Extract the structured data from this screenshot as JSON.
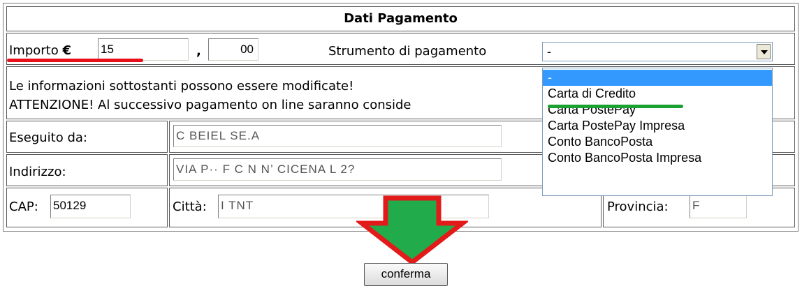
{
  "header": {
    "title": "Dati Pagamento"
  },
  "amount": {
    "label_prefix": "Importo ",
    "currency": "€",
    "euros": "15",
    "separator": ",",
    "cents": "00"
  },
  "payment_method": {
    "label": "Strumento di pagamento",
    "selected": "-",
    "options": [
      "-",
      "Carta di Credito",
      "Carta PostePay",
      "Carta PostePay Impresa",
      "Conto BancoPosta",
      "Conto BancoPosta Impresa"
    ]
  },
  "notice": {
    "line1": "Le informazioni sottostanti possono essere modificate!",
    "line2": "ATTENZIONE! Al successivo pagamento on line saranno conside"
  },
  "payer": {
    "executed_by_label": "Eseguito da:",
    "executed_by_value": "C  BEIEL  SE.A",
    "address_label": "Indirizzo:",
    "address_value": "VIA  P··  F C  N  N’  CICENA  L  2?",
    "cap_label": "CAP:",
    "cap_value": "50129",
    "city_label": "Città:",
    "city_value": "I  TNT",
    "province_label": "Provincia:",
    "province_value": "F"
  },
  "submit": {
    "label": "conferma"
  },
  "colors": {
    "highlight_red": "#e8101a",
    "highlight_green": "#1da032",
    "arrow_green": "#22ab4a",
    "arrow_red": "#e21a1a",
    "option_selected": "#3399ff"
  }
}
